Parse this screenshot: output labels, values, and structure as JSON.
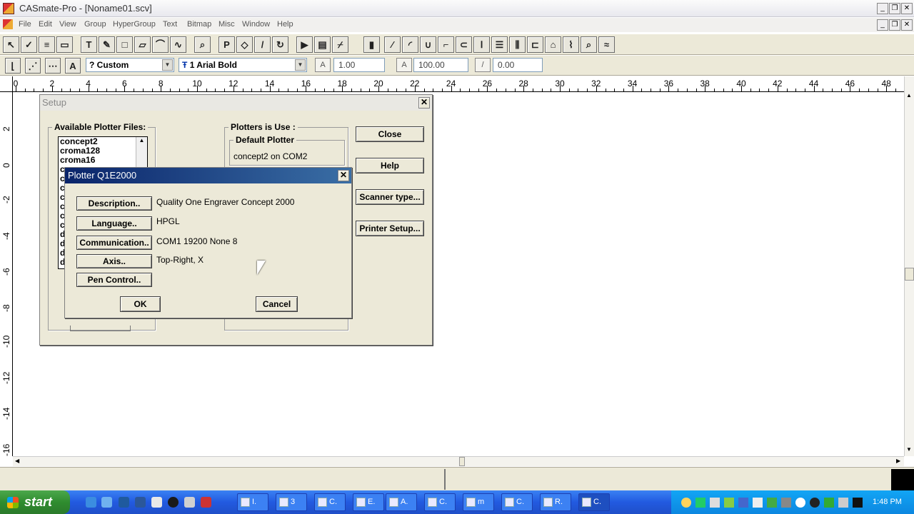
{
  "app": {
    "title": "CASmate-Pro - [Noname01.scv]"
  },
  "window_controls": {
    "minimize": "_",
    "restore": "❐",
    "close": "✕"
  },
  "menu": [
    "File",
    "Edit",
    "View",
    "Group",
    "HyperGroup",
    "Text",
    "Bitmap",
    "Misc",
    "Window",
    "Help"
  ],
  "toolbar2": {
    "style_combo": "? Custom",
    "font_combo": "1 Arial Bold",
    "font_prefix": "Ŧ",
    "scale_value": "1.00",
    "size_value": "100.00",
    "slant_value": "0.00"
  },
  "ruler": {
    "h_labels": [
      "0",
      "2",
      "4",
      "6",
      "8",
      "10",
      "12",
      "14",
      "16",
      "18",
      "20",
      "22",
      "24",
      "26",
      "28",
      "30",
      "32",
      "34",
      "36",
      "38",
      "40",
      "42",
      "44",
      "46",
      "48"
    ],
    "v_labels": [
      "2",
      "0",
      "-2",
      "-4",
      "-6",
      "-8",
      "-10",
      "-12",
      "-14",
      "-16"
    ]
  },
  "setup_dialog": {
    "title": "Setup",
    "available_label": "Available Plotter Files:",
    "plotter_files": [
      "concept2",
      "croma128",
      "croma16",
      "c",
      "c",
      "c",
      "c",
      "c",
      "c",
      "c",
      "d",
      "d",
      "d",
      "d"
    ],
    "in_use_label": "Plotters is Use :",
    "default_label": "Default Plotter",
    "default_value": "concept2  on COM2",
    "buttons": {
      "close": "Close",
      "help": "Help",
      "scanner": "Scanner type...",
      "printer": "Printer Setup..."
    }
  },
  "plotter_dialog": {
    "title": "Plotter Q1E2000",
    "rows": [
      {
        "button": "Description..",
        "value": "Quality One Engraver Concept 2000"
      },
      {
        "button": "Language..",
        "value": "HPGL"
      },
      {
        "button": "Communication..",
        "value": "COM1 19200 None 8"
      },
      {
        "button": "Axis..",
        "value": "Top-Right, X"
      },
      {
        "button": "Pen Control..",
        "value": ""
      }
    ],
    "ok": "OK",
    "cancel": "Cancel"
  },
  "taskbar": {
    "start": "start",
    "items": [
      {
        "label": "I."
      },
      {
        "label": "3"
      },
      {
        "label": "C."
      },
      {
        "label": "E."
      },
      {
        "label": "A."
      },
      {
        "label": "C."
      },
      {
        "label": "m"
      },
      {
        "label": "C."
      },
      {
        "label": "R."
      },
      {
        "label": "C."
      }
    ],
    "clock": "1:48 PM"
  }
}
